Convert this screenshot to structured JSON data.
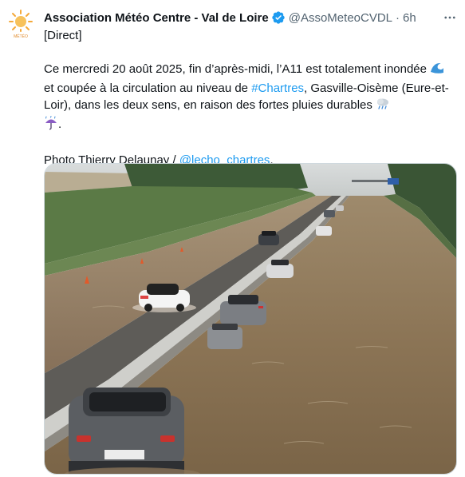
{
  "tweet": {
    "author": {
      "display_name": "Association Météo Centre - Val de Loire",
      "handle": "@AssoMeteoCVDL",
      "avatar_text": "MÉTÉO",
      "verified": true
    },
    "separator": "·",
    "time": "6h",
    "more_icon": "more-horizontal-icon",
    "text": {
      "line1": "[Direct]",
      "para2_part1": "Ce mercredi 20 août 2025, fin d’après-midi, l’A11 est totalement inondée ",
      "para2_part2": " et coupée à la circulation au niveau de ",
      "hashtag": "#Chartres",
      "para2_part3": ", Gasville-Oisème (Eure-et-Loir), dans les deux sens, en raison des fortes pluies durables ",
      "para2_end": ".",
      "photo_credit_prefix": "Photo Thierry Delaunay / ",
      "mention": "@lecho_chartres",
      "photo_credit_suffix": "."
    },
    "emojis": [
      "wave-emoji",
      "cloud-rain-emoji",
      "umbrella-rain-emoji"
    ],
    "colors": {
      "link": "#1d9bf0",
      "verified": "#1d9bf0",
      "secondary_text": "#536471"
    }
  }
}
